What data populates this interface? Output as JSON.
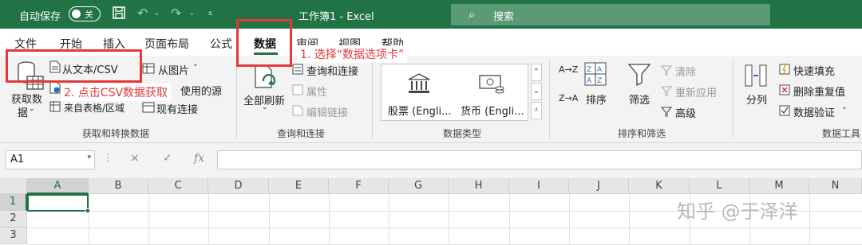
{
  "titlebar": {
    "autosave_label": "自动保存",
    "autosave_state": "关",
    "save_icon": "save-icon",
    "undo_icon": "undo-icon",
    "redo_icon": "redo-icon",
    "customize_icon": "chevron-down-icon",
    "document_title": "工作簿1  -  Excel",
    "search_placeholder": "搜索",
    "accent_color": "#217346"
  },
  "menu": {
    "tabs": [
      "文件",
      "开始",
      "插入",
      "页面布局",
      "公式",
      "数据",
      "审阅",
      "视图",
      "帮助"
    ],
    "active_tab": "数据"
  },
  "ribbon": {
    "get_transform": {
      "get_data_line1": "获取数",
      "get_data_line2": "据",
      "from_text_csv": "从文本/CSV",
      "from_picture": "从图片",
      "recent_sources": "使用的源",
      "from_table_range": "来自表格/区域",
      "existing_connections": "现有连接",
      "group_label": "获取和转换数据"
    },
    "queries": {
      "refresh_all": "全部刷新",
      "queries_connections": "查询和连接",
      "properties": "属性",
      "edit_links": "编辑链接",
      "group_label": "查询和连接"
    },
    "data_types": {
      "stocks": "股票 (Engli...",
      "currencies": "货币 (Engli...",
      "group_label": "数据类型"
    },
    "sort_filter": {
      "sort_az": "A→Z",
      "sort_za": "Z→A",
      "sort": "排序",
      "filter": "筛选",
      "clear": "清除",
      "reapply": "重新应用",
      "advanced": "高级",
      "group_label": "排序和筛选"
    },
    "data_tools": {
      "text_to_columns": "分列",
      "flash_fill": "快速填充",
      "remove_duplicates": "删除重复值",
      "data_validation": "数据验证",
      "group_label": "数据工具"
    }
  },
  "annotations": {
    "step1": "1. 选择“数据选项卡”",
    "step2": "2. 点击CSV数据获取",
    "color": "#e5383b"
  },
  "formula_bar": {
    "name_box": "A1",
    "cancel_icon": "×",
    "enter_icon": "✓",
    "fx_label": "fx",
    "formula_value": ""
  },
  "grid": {
    "columns": [
      "A",
      "B",
      "C",
      "D",
      "E",
      "F",
      "G",
      "H",
      "I",
      "J",
      "K",
      "L",
      "M",
      "N"
    ],
    "rows": [
      "1",
      "2",
      "3"
    ],
    "selected_cell": "A1"
  },
  "watermark": "知乎 @于泽洋"
}
